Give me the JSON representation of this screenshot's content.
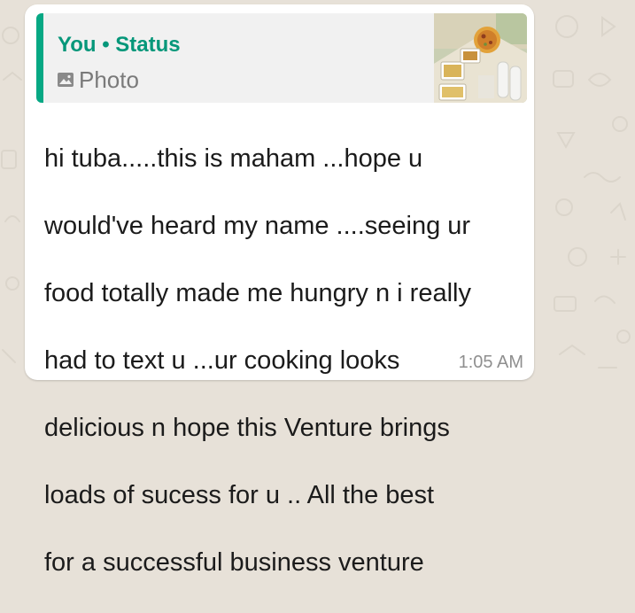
{
  "quote": {
    "author": "You • Status",
    "media_label": "Photo",
    "media_icon": "photo-icon",
    "accent_color": "#06a884"
  },
  "message": {
    "lines": [
      "hi tuba.....this is maham ...hope u",
      "would've heard my name ....seeing ur",
      "food totally made me hungry n i really",
      "had to text u ...ur cooking looks",
      "delicious n hope this Venture brings",
      "loads of sucess for u .. All the best",
      "for a successful business venture"
    ],
    "time": "1:05 AM"
  }
}
